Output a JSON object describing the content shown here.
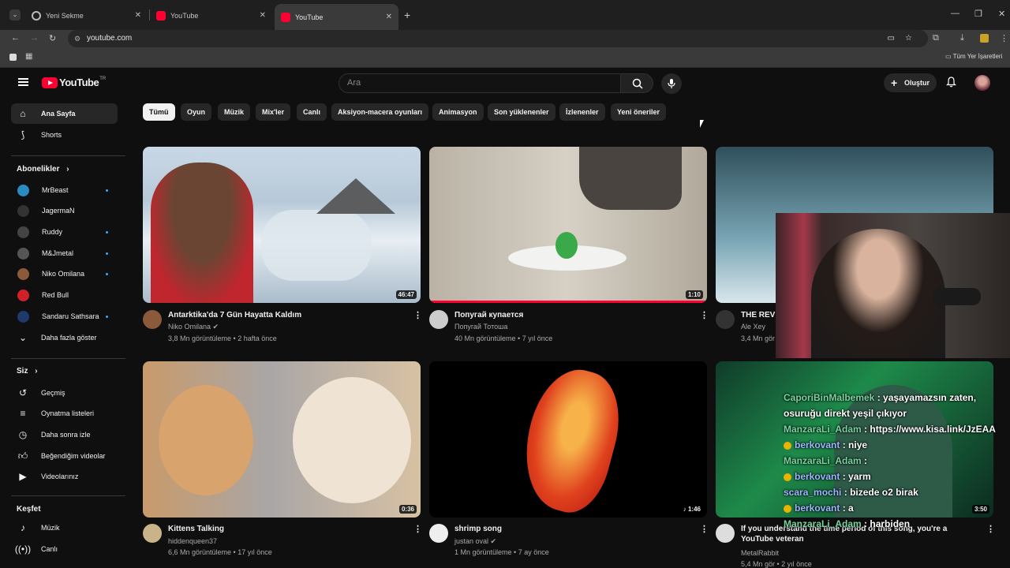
{
  "browser": {
    "tabs": [
      {
        "title": "Yeni Sekme"
      },
      {
        "title": "YouTube"
      },
      {
        "title": "YouTube"
      }
    ],
    "url": "youtube.com",
    "bookmarks_label": "Tüm Yer İşaretleri"
  },
  "youtube": {
    "search_placeholder": "Ara",
    "create_label": "Oluştur",
    "logo_text": "YouTube",
    "logo_region": "TR"
  },
  "sidebar": {
    "main": [
      {
        "label": "Ana Sayfa",
        "icon": "home-icon"
      },
      {
        "label": "Shorts",
        "icon": "shorts-icon"
      }
    ],
    "subs_header": "Abonelikler",
    "subs": [
      {
        "label": "MrBeast",
        "color": "#2b8ac0",
        "dot": true
      },
      {
        "label": "JagermaN",
        "color": "#333333",
        "dot": false
      },
      {
        "label": "Ruddy",
        "color": "#444444",
        "dot": true
      },
      {
        "label": "M&Jmetal",
        "color": "#555555",
        "dot": true
      },
      {
        "label": "Niko Omilana",
        "color": "#8a5a3a",
        "dot": true
      },
      {
        "label": "Red Bull",
        "color": "#d0202a",
        "dot": false
      },
      {
        "label": "Sandaru Sathsara",
        "color": "#1d3a6a",
        "dot": true
      }
    ],
    "show_more": "Daha fazla göster",
    "you_header": "Siz",
    "you": [
      {
        "label": "Geçmiş",
        "icon": "history-icon"
      },
      {
        "label": "Oynatma listeleri",
        "icon": "playlist-icon"
      },
      {
        "label": "Daha sonra izle",
        "icon": "watch-later-icon"
      },
      {
        "label": "Beğendiğim videolar",
        "icon": "like-icon"
      },
      {
        "label": "Videolarınız",
        "icon": "your-videos-icon"
      }
    ],
    "explore_header": "Keşfet",
    "explore": [
      {
        "label": "Müzik",
        "icon": "music-icon"
      },
      {
        "label": "Canlı",
        "icon": "live-icon"
      }
    ]
  },
  "chips": [
    "Tümü",
    "Oyun",
    "Müzik",
    "Mix'ler",
    "Canlı",
    "Aksiyon-macera oyunları",
    "Animasyon",
    "Son yüklenenler",
    "İzlenenler",
    "Yeni öneriler"
  ],
  "videos": [
    {
      "title": "Antarktika'da 7 Gün Hayatta Kaldım",
      "channel": "Niko Omilana",
      "meta": "3,8 Mn görüntüleme • 2 hafta önce",
      "duration": "46:47"
    },
    {
      "title": "Попугай купается",
      "channel": "Попугай Тотоша",
      "meta": "40 Mn görüntüleme • 7 yıl önce",
      "duration": "1:10"
    },
    {
      "title": "THE REVI",
      "channel": "Ale Xey",
      "meta": "3,4 Mn gör",
      "duration": ""
    },
    {
      "title": "Kittens Talking",
      "channel": "hiddenqueen37",
      "meta": "6,6 Mn görüntüleme • 17 yıl önce",
      "duration": "0:36"
    },
    {
      "title": "shrimp song",
      "channel": "justan oval",
      "meta": "1 Mn görüntüleme • 7 ay önce",
      "duration": "1:46"
    },
    {
      "title": "If you understand the time period of this song, you're a YouTube veteran",
      "channel": "MetalRabbit",
      "meta": "5,4 Mn gör • 2 yıl önce",
      "duration": "3:50"
    }
  ],
  "chat": [
    {
      "user": "CaporiBinMalbemek",
      "msg": "yaşayamazsın zaten, osuruğu direkt yeşil çıkıyor"
    },
    {
      "user": "ManzaraLi_Adam",
      "msg": "https://www.kisa.link/JzEAA"
    },
    {
      "user": "berkovant",
      "msg": "niye"
    },
    {
      "user": "ManzaraLi_Adam",
      "msg": ""
    },
    {
      "user": "berkovant",
      "msg": "yarm"
    },
    {
      "user": "scara_mochi",
      "msg": "bizede o2 birak"
    },
    {
      "user": "berkovant",
      "msg": "a"
    },
    {
      "user": "ManzaraLi_Adam",
      "msg": "harbiden"
    }
  ]
}
